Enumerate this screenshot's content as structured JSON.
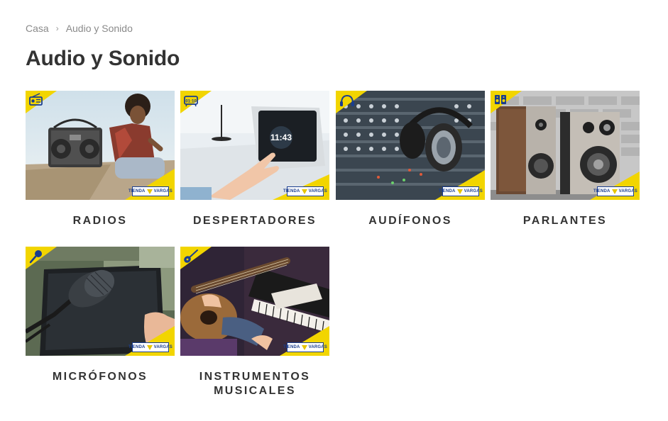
{
  "breadcrumb": {
    "home": "Casa",
    "separator": "›",
    "current": "Audio y Sonido"
  },
  "page_title": "Audio y Sonido",
  "brand_logo": {
    "left": "TIENDA",
    "right": "VARGAS"
  },
  "colors": {
    "accent_yellow": "#f2d500",
    "brand_blue": "#1a3d8f",
    "text": "#333333",
    "muted": "#8a8a8a"
  },
  "categories": [
    {
      "label": "RADIOS",
      "corner_icon": "radio-icon"
    },
    {
      "label": "DESPERTADORES",
      "corner_icon": "alarm-clock-icon",
      "screen_time": "11:43"
    },
    {
      "label": "AUDÍFONOS",
      "corner_icon": "headphones-icon"
    },
    {
      "label": "PARLANTES",
      "corner_icon": "speakers-icon"
    },
    {
      "label": "MICRÓFONOS",
      "corner_icon": "microphone-icon"
    },
    {
      "label": "INSTRUMENTOS MUSICALES",
      "corner_icon": "guitar-icon"
    }
  ]
}
